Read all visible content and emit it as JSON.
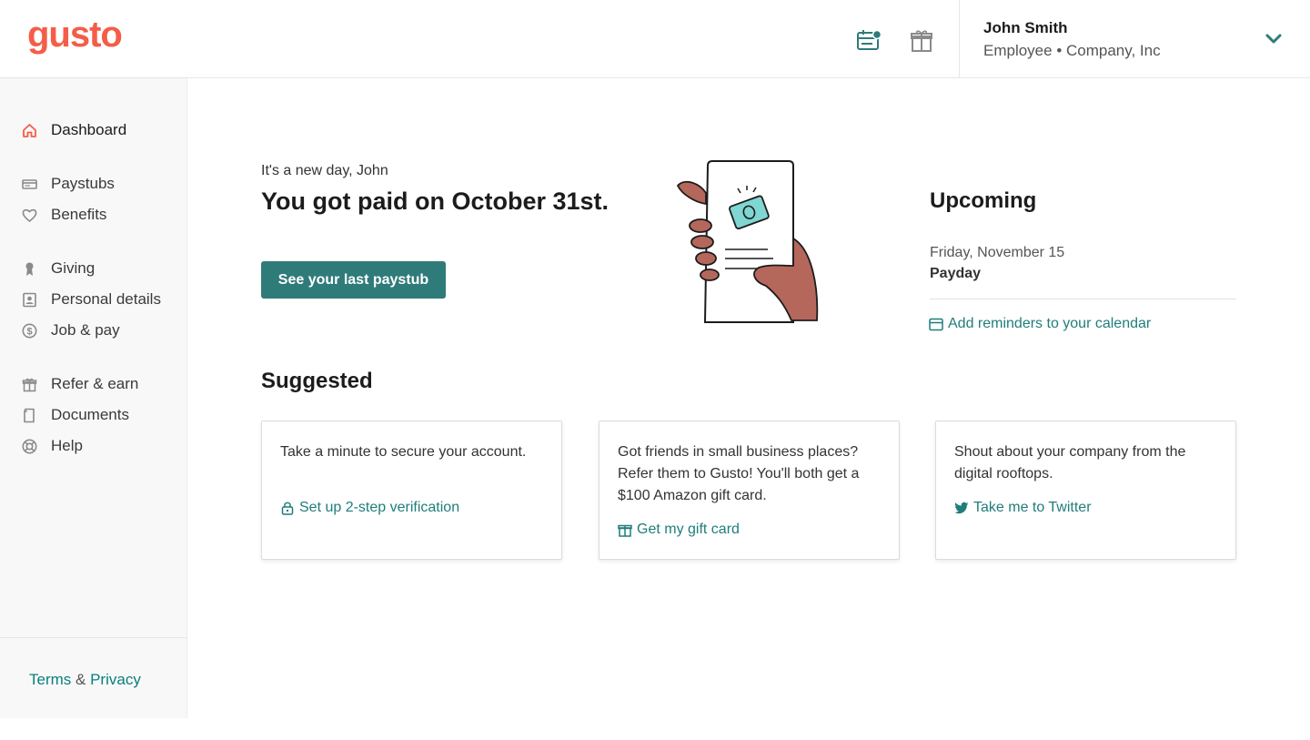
{
  "header": {
    "logo": "gusto",
    "user": {
      "name": "John Smith",
      "subtitle": "Employee • Company, Inc"
    }
  },
  "sidebar": {
    "items": [
      {
        "label": "Dashboard",
        "icon": "home-icon",
        "active": true
      },
      {
        "label": "Paystubs",
        "icon": "paystub-icon"
      },
      {
        "label": "Benefits",
        "icon": "heart-icon"
      },
      {
        "label": "Giving",
        "icon": "ribbon-icon"
      },
      {
        "label": "Personal details",
        "icon": "id-card-icon"
      },
      {
        "label": "Job & pay",
        "icon": "dollar-icon"
      },
      {
        "label": "Refer & earn",
        "icon": "gift-icon"
      },
      {
        "label": "Documents",
        "icon": "document-icon"
      },
      {
        "label": "Help",
        "icon": "lifebuoy-icon"
      }
    ],
    "footer": {
      "terms": "Terms",
      "amp": "&",
      "privacy": "Privacy"
    }
  },
  "main": {
    "greeting": "It's a new day, John",
    "headline": "You got paid on October 31st.",
    "cta": "See your last paystub",
    "upcoming": {
      "title": "Upcoming",
      "date": "Friday, November 15",
      "event": "Payday",
      "calendar_link": "Add reminders to your calendar"
    },
    "suggested": {
      "title": "Suggested",
      "cards": [
        {
          "text": "Take a minute to secure your account.",
          "link": "Set up 2-step verification",
          "icon": "lock-icon"
        },
        {
          "text": "Got friends in small business places? Refer them to Gusto! You'll both get a $100 Amazon gift card.",
          "link": "Get my gift card",
          "icon": "gift-icon"
        },
        {
          "text": "Shout about your company from the digital rooftops.",
          "link": "Take me to Twitter",
          "icon": "twitter-icon"
        }
      ]
    }
  },
  "colors": {
    "brand": "#f45d48",
    "accent": "#2f7b7a",
    "link": "#1f7d7b"
  }
}
